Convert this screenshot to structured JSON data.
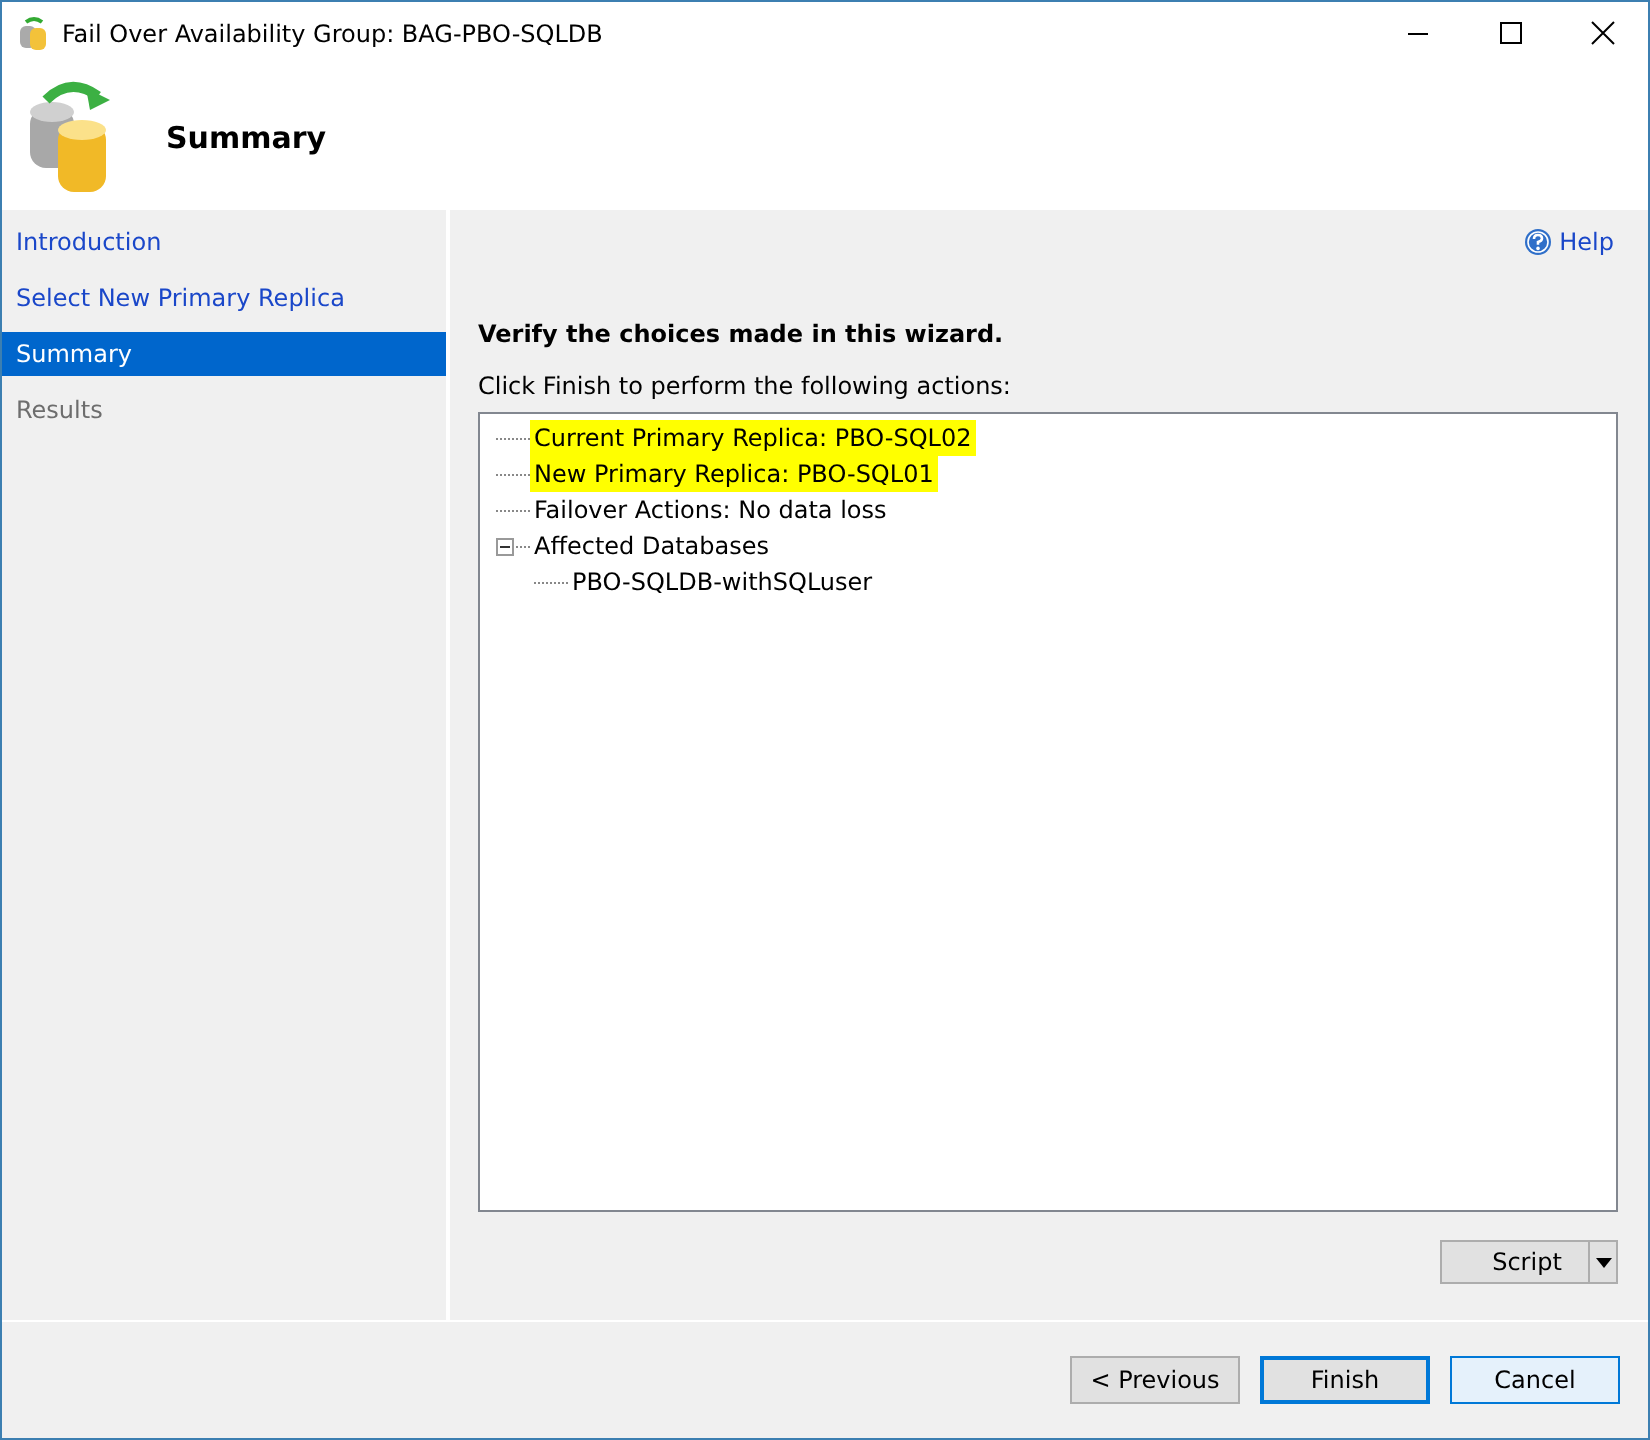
{
  "window": {
    "title": "Fail Over Availability Group: BAG-PBO-SQLDB"
  },
  "header": {
    "title": "Summary"
  },
  "sidebar": {
    "items": [
      {
        "label": "Introduction",
        "selected": false,
        "disabled": false
      },
      {
        "label": "Select New Primary Replica",
        "selected": false,
        "disabled": false
      },
      {
        "label": "Summary",
        "selected": true,
        "disabled": false
      },
      {
        "label": "Results",
        "selected": false,
        "disabled": true
      }
    ]
  },
  "help": "Help",
  "heading": "Verify the choices made in this wizard.",
  "instruction": "Click Finish to perform the following actions:",
  "tree": [
    {
      "label": "Current Primary Replica: PBO-SQL02",
      "highlighted": true
    },
    {
      "label": "New Primary Replica: PBO-SQL01",
      "highlighted": true
    },
    {
      "label": "Failover Actions: No data loss",
      "highlighted": false
    },
    {
      "label": "Affected Databases",
      "highlighted": false,
      "expanded": true,
      "children": [
        {
          "label": "PBO-SQLDB-withSQLuser",
          "highlighted": false
        }
      ]
    }
  ],
  "script_button": "Script",
  "buttons": [
    {
      "label": "< Previous",
      "kind": "normal"
    },
    {
      "label": "Finish",
      "kind": "default"
    },
    {
      "label": "Cancel",
      "kind": "hover"
    }
  ]
}
